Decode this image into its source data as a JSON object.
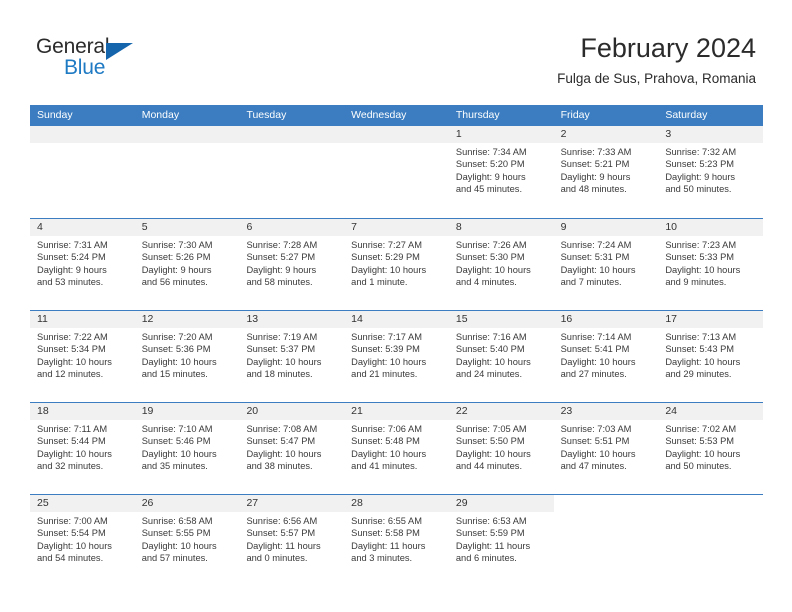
{
  "brand": {
    "name_part1": "General",
    "name_part2": "Blue"
  },
  "header": {
    "title": "February 2024",
    "subtitle": "Fulga de Sus, Prahova, Romania"
  },
  "colors": {
    "header_blue": "#3b7dc0",
    "brand_blue": "#1f7ac4",
    "day_bar_gray": "#f1f1f1"
  },
  "weekdays": [
    "Sunday",
    "Monday",
    "Tuesday",
    "Wednesday",
    "Thursday",
    "Friday",
    "Saturday"
  ],
  "weeks": [
    [
      {
        "day": "",
        "empty": true
      },
      {
        "day": "",
        "empty": true
      },
      {
        "day": "",
        "empty": true
      },
      {
        "day": "",
        "empty": true
      },
      {
        "day": "1",
        "sunrise": "Sunrise: 7:34 AM",
        "sunset": "Sunset: 5:20 PM",
        "daylight_line1": "Daylight: 9 hours",
        "daylight_line2": "and 45 minutes."
      },
      {
        "day": "2",
        "sunrise": "Sunrise: 7:33 AM",
        "sunset": "Sunset: 5:21 PM",
        "daylight_line1": "Daylight: 9 hours",
        "daylight_line2": "and 48 minutes."
      },
      {
        "day": "3",
        "sunrise": "Sunrise: 7:32 AM",
        "sunset": "Sunset: 5:23 PM",
        "daylight_line1": "Daylight: 9 hours",
        "daylight_line2": "and 50 minutes."
      }
    ],
    [
      {
        "day": "4",
        "sunrise": "Sunrise: 7:31 AM",
        "sunset": "Sunset: 5:24 PM",
        "daylight_line1": "Daylight: 9 hours",
        "daylight_line2": "and 53 minutes."
      },
      {
        "day": "5",
        "sunrise": "Sunrise: 7:30 AM",
        "sunset": "Sunset: 5:26 PM",
        "daylight_line1": "Daylight: 9 hours",
        "daylight_line2": "and 56 minutes."
      },
      {
        "day": "6",
        "sunrise": "Sunrise: 7:28 AM",
        "sunset": "Sunset: 5:27 PM",
        "daylight_line1": "Daylight: 9 hours",
        "daylight_line2": "and 58 minutes."
      },
      {
        "day": "7",
        "sunrise": "Sunrise: 7:27 AM",
        "sunset": "Sunset: 5:29 PM",
        "daylight_line1": "Daylight: 10 hours",
        "daylight_line2": "and 1 minute."
      },
      {
        "day": "8",
        "sunrise": "Sunrise: 7:26 AM",
        "sunset": "Sunset: 5:30 PM",
        "daylight_line1": "Daylight: 10 hours",
        "daylight_line2": "and 4 minutes."
      },
      {
        "day": "9",
        "sunrise": "Sunrise: 7:24 AM",
        "sunset": "Sunset: 5:31 PM",
        "daylight_line1": "Daylight: 10 hours",
        "daylight_line2": "and 7 minutes."
      },
      {
        "day": "10",
        "sunrise": "Sunrise: 7:23 AM",
        "sunset": "Sunset: 5:33 PM",
        "daylight_line1": "Daylight: 10 hours",
        "daylight_line2": "and 9 minutes."
      }
    ],
    [
      {
        "day": "11",
        "sunrise": "Sunrise: 7:22 AM",
        "sunset": "Sunset: 5:34 PM",
        "daylight_line1": "Daylight: 10 hours",
        "daylight_line2": "and 12 minutes."
      },
      {
        "day": "12",
        "sunrise": "Sunrise: 7:20 AM",
        "sunset": "Sunset: 5:36 PM",
        "daylight_line1": "Daylight: 10 hours",
        "daylight_line2": "and 15 minutes."
      },
      {
        "day": "13",
        "sunrise": "Sunrise: 7:19 AM",
        "sunset": "Sunset: 5:37 PM",
        "daylight_line1": "Daylight: 10 hours",
        "daylight_line2": "and 18 minutes."
      },
      {
        "day": "14",
        "sunrise": "Sunrise: 7:17 AM",
        "sunset": "Sunset: 5:39 PM",
        "daylight_line1": "Daylight: 10 hours",
        "daylight_line2": "and 21 minutes."
      },
      {
        "day": "15",
        "sunrise": "Sunrise: 7:16 AM",
        "sunset": "Sunset: 5:40 PM",
        "daylight_line1": "Daylight: 10 hours",
        "daylight_line2": "and 24 minutes."
      },
      {
        "day": "16",
        "sunrise": "Sunrise: 7:14 AM",
        "sunset": "Sunset: 5:41 PM",
        "daylight_line1": "Daylight: 10 hours",
        "daylight_line2": "and 27 minutes."
      },
      {
        "day": "17",
        "sunrise": "Sunrise: 7:13 AM",
        "sunset": "Sunset: 5:43 PM",
        "daylight_line1": "Daylight: 10 hours",
        "daylight_line2": "and 29 minutes."
      }
    ],
    [
      {
        "day": "18",
        "sunrise": "Sunrise: 7:11 AM",
        "sunset": "Sunset: 5:44 PM",
        "daylight_line1": "Daylight: 10 hours",
        "daylight_line2": "and 32 minutes."
      },
      {
        "day": "19",
        "sunrise": "Sunrise: 7:10 AM",
        "sunset": "Sunset: 5:46 PM",
        "daylight_line1": "Daylight: 10 hours",
        "daylight_line2": "and 35 minutes."
      },
      {
        "day": "20",
        "sunrise": "Sunrise: 7:08 AM",
        "sunset": "Sunset: 5:47 PM",
        "daylight_line1": "Daylight: 10 hours",
        "daylight_line2": "and 38 minutes."
      },
      {
        "day": "21",
        "sunrise": "Sunrise: 7:06 AM",
        "sunset": "Sunset: 5:48 PM",
        "daylight_line1": "Daylight: 10 hours",
        "daylight_line2": "and 41 minutes."
      },
      {
        "day": "22",
        "sunrise": "Sunrise: 7:05 AM",
        "sunset": "Sunset: 5:50 PM",
        "daylight_line1": "Daylight: 10 hours",
        "daylight_line2": "and 44 minutes."
      },
      {
        "day": "23",
        "sunrise": "Sunrise: 7:03 AM",
        "sunset": "Sunset: 5:51 PM",
        "daylight_line1": "Daylight: 10 hours",
        "daylight_line2": "and 47 minutes."
      },
      {
        "day": "24",
        "sunrise": "Sunrise: 7:02 AM",
        "sunset": "Sunset: 5:53 PM",
        "daylight_line1": "Daylight: 10 hours",
        "daylight_line2": "and 50 minutes."
      }
    ],
    [
      {
        "day": "25",
        "sunrise": "Sunrise: 7:00 AM",
        "sunset": "Sunset: 5:54 PM",
        "daylight_line1": "Daylight: 10 hours",
        "daylight_line2": "and 54 minutes."
      },
      {
        "day": "26",
        "sunrise": "Sunrise: 6:58 AM",
        "sunset": "Sunset: 5:55 PM",
        "daylight_line1": "Daylight: 10 hours",
        "daylight_line2": "and 57 minutes."
      },
      {
        "day": "27",
        "sunrise": "Sunrise: 6:56 AM",
        "sunset": "Sunset: 5:57 PM",
        "daylight_line1": "Daylight: 11 hours",
        "daylight_line2": "and 0 minutes."
      },
      {
        "day": "28",
        "sunrise": "Sunrise: 6:55 AM",
        "sunset": "Sunset: 5:58 PM",
        "daylight_line1": "Daylight: 11 hours",
        "daylight_line2": "and 3 minutes."
      },
      {
        "day": "29",
        "sunrise": "Sunrise: 6:53 AM",
        "sunset": "Sunset: 5:59 PM",
        "daylight_line1": "Daylight: 11 hours",
        "daylight_line2": "and 6 minutes."
      },
      {
        "day": "",
        "empty": true,
        "blank": true
      },
      {
        "day": "",
        "empty": true,
        "blank": true
      }
    ]
  ]
}
